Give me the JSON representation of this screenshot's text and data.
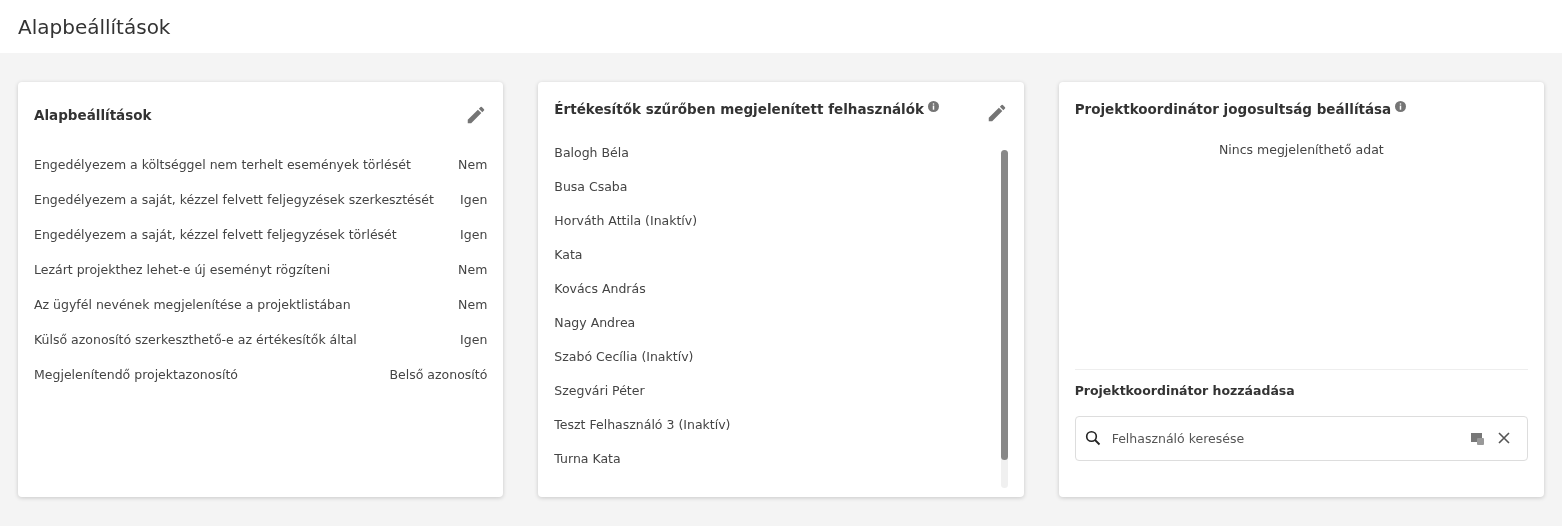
{
  "page_title": "Alapbeállítások",
  "settings_card": {
    "title": "Alapbeállítások",
    "rows": [
      {
        "label": "Engedélyezem a költséggel nem terhelt események törlését",
        "value": "Nem"
      },
      {
        "label": "Engedélyezem a saját, kézzel felvett feljegyzések szerkesztését",
        "value": "Igen"
      },
      {
        "label": "Engedélyezem a saját, kézzel felvett feljegyzések törlését",
        "value": "Igen"
      },
      {
        "label": "Lezárt projekthez lehet-e új eseményt rögzíteni",
        "value": "Nem"
      },
      {
        "label": "Az ügyfél nevének megjelenítése a projektlistában",
        "value": "Nem"
      },
      {
        "label": "Külső azonosító szerkeszthető-e az értékesítők által",
        "value": "Igen"
      },
      {
        "label": "Megjelenítendő projektazonosító",
        "value": "Belső azonosító"
      }
    ]
  },
  "users_card": {
    "title": "Értékesítők szűrőben megjelenített felhasználók",
    "users": [
      "Balogh Béla",
      "Busa Csaba",
      "Horváth Attila (Inaktív)",
      "Kata",
      "Kovács András",
      "Nagy Andrea",
      "Szabó Cecília (Inaktív)",
      "Szegvári Péter",
      "Teszt Felhasználó 3 (Inaktív)",
      "Turna Kata"
    ]
  },
  "coordinator_card": {
    "title": "Projektkoordinátor jogosultság beállítása",
    "empty_text": "Nincs megjeleníthető adat",
    "add_title": "Projektkoordinátor hozzáadása",
    "search": {
      "placeholder": "Felhasználó keresése"
    }
  }
}
